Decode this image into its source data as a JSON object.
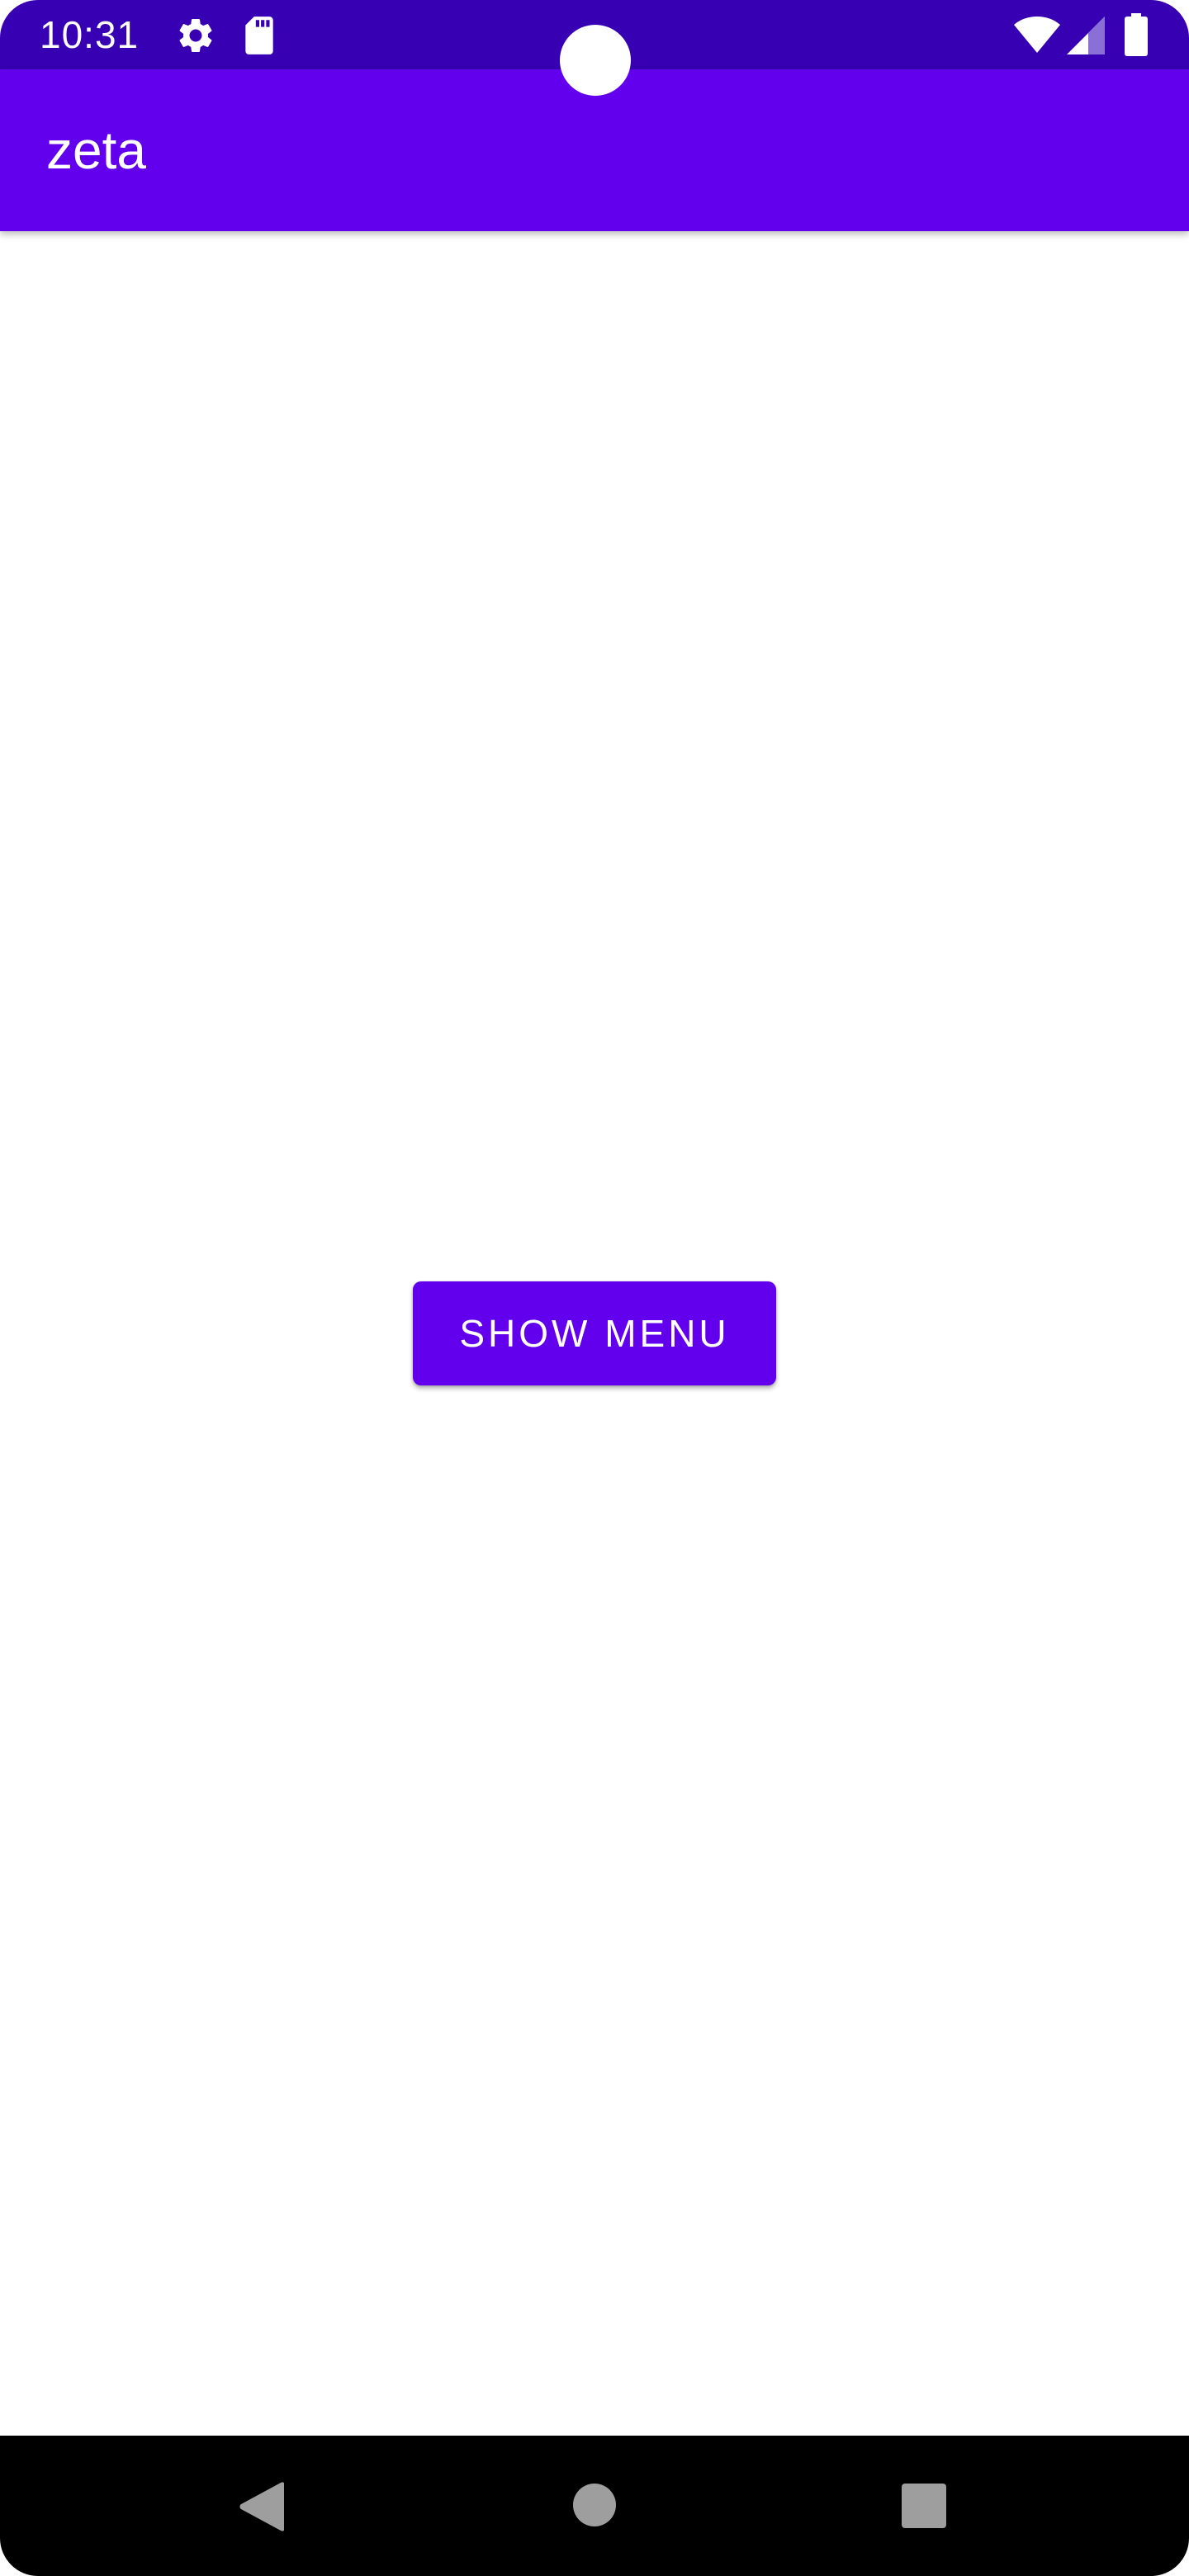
{
  "status_bar": {
    "time": "10:31",
    "icons": [
      "settings-icon",
      "sd-card-icon",
      "wifi-icon",
      "cellular-signal-icon",
      "battery-icon"
    ],
    "background_color": "#3700b3"
  },
  "app_bar": {
    "title": "zeta",
    "background_color": "#6200ee"
  },
  "main": {
    "show_menu_button_label": "SHOW MENU"
  },
  "nav_bar": {
    "buttons": [
      "back-icon",
      "home-icon",
      "recents-icon"
    ]
  },
  "colors": {
    "primary": "#6200ee",
    "primary_dark": "#3700b3",
    "nav_icon": "#9e9e9e"
  }
}
